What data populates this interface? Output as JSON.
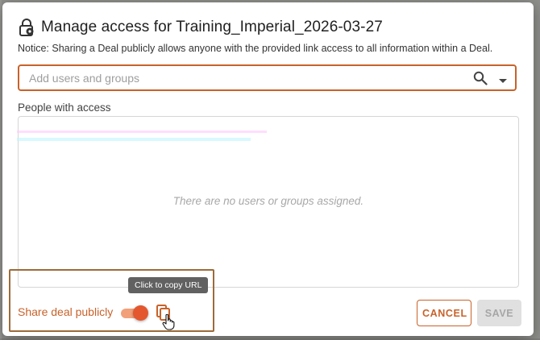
{
  "dialog": {
    "title": "Manage access for Training_Imperial_2026-03-27",
    "notice": "Notice: Sharing a Deal publicly allows anyone with the provided link access to all information within a Deal."
  },
  "search": {
    "placeholder": "Add users and groups",
    "value": ""
  },
  "people": {
    "label": "People with access",
    "empty_text": "There are no users or groups assigned."
  },
  "share": {
    "label": "Share deal publicly",
    "enabled": true,
    "copy_tooltip": "Click to copy URL"
  },
  "actions": {
    "cancel_label": "CANCEL",
    "save_label": "SAVE"
  },
  "colors": {
    "accent": "#c8622a",
    "toggle_thumb": "#e4572e",
    "toggle_track": "#f2a07a",
    "disabled_bg": "#e0e0e0"
  },
  "icons": {
    "title": "lock-settings-icon",
    "search": "search-icon",
    "dropdown": "chevron-down-icon",
    "copy": "copy-icon",
    "cursor": "hand-pointer-icon"
  }
}
